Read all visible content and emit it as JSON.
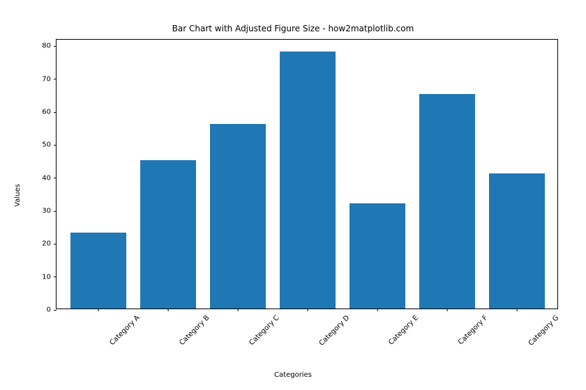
{
  "chart_data": {
    "type": "bar",
    "title": "Bar Chart with Adjusted Figure Size - how2matplotlib.com",
    "xlabel": "Categories",
    "ylabel": "Values",
    "categories": [
      "Category A",
      "Category B",
      "Category C",
      "Category D",
      "Category E",
      "Category F",
      "Category G"
    ],
    "values": [
      23,
      45,
      56,
      78,
      32,
      65,
      41
    ],
    "yticks": [
      0,
      10,
      20,
      30,
      40,
      50,
      60,
      70,
      80
    ],
    "ylim": [
      0,
      82
    ],
    "bar_color": "#1f77b4"
  }
}
